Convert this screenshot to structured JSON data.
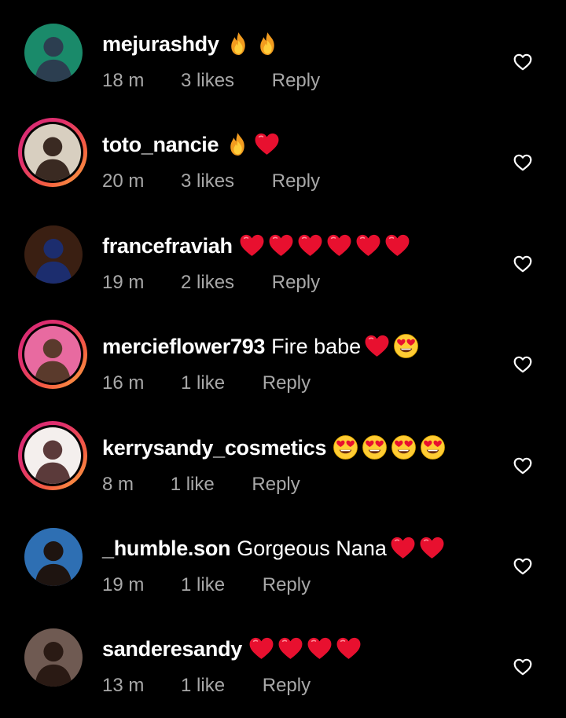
{
  "comments": [
    {
      "username": "mejurashdy",
      "text": "",
      "emojis": [
        "fire-emoji",
        "fire-emoji"
      ],
      "time": "18 m",
      "likes": "3 likes",
      "reply": "Reply",
      "has_story": false,
      "avatar_colors": [
        "#1a8a6a",
        "#2c3e50"
      ]
    },
    {
      "username": "toto_nancie",
      "text": "",
      "emojis": [
        "fire-emoji",
        "red-heart-emoji"
      ],
      "time": "20 m",
      "likes": "3 likes",
      "reply": "Reply",
      "has_story": true,
      "avatar_colors": [
        "#d8cfc0",
        "#3a2a22"
      ]
    },
    {
      "username": "francefraviah",
      "text": "",
      "emojis": [
        "red-heart-emoji",
        "red-heart-emoji",
        "red-heart-emoji",
        "red-heart-emoji",
        "red-heart-emoji",
        "red-heart-emoji"
      ],
      "time": "19 m",
      "likes": "2 likes",
      "reply": "Reply",
      "has_story": false,
      "avatar_colors": [
        "#3a1f12",
        "#1c2d6e"
      ]
    },
    {
      "username": "mercieflower793",
      "text": "Fire babe",
      "emojis": [
        "red-heart-emoji",
        "heart-eyes-emoji"
      ],
      "time": "16 m",
      "likes": "1 like",
      "reply": "Reply",
      "has_story": true,
      "avatar_colors": [
        "#e86aa0",
        "#5a3a2c"
      ]
    },
    {
      "username": "kerrysandy_cosmetics",
      "text": "",
      "emojis": [
        "heart-eyes-emoji",
        "heart-eyes-emoji",
        "heart-eyes-emoji",
        "heart-eyes-emoji"
      ],
      "time": "8 m",
      "likes": "1 like",
      "reply": "Reply",
      "has_story": true,
      "avatar_colors": [
        "#f4efed",
        "#5b3a3a"
      ]
    },
    {
      "username": "_humble.son",
      "text": "Gorgeous Nana",
      "emojis": [
        "red-heart-emoji",
        "red-heart-emoji"
      ],
      "time": "19 m",
      "likes": "1 like",
      "reply": "Reply",
      "has_story": false,
      "avatar_colors": [
        "#2e6fb3",
        "#1e1410"
      ]
    },
    {
      "username": "sanderesandy",
      "text": "",
      "emojis": [
        "red-heart-emoji",
        "red-heart-emoji",
        "red-heart-emoji",
        "red-heart-emoji"
      ],
      "time": "13 m",
      "likes": "1 like",
      "reply": "Reply",
      "has_story": false,
      "avatar_colors": [
        "#6f5a52",
        "#2a1a14"
      ]
    }
  ],
  "colors": {
    "background": "#000000",
    "text_primary": "#ffffff",
    "text_secondary": "#a8a8a8",
    "story_ring_start": "#d62976",
    "story_ring_end": "#fcaf45"
  }
}
